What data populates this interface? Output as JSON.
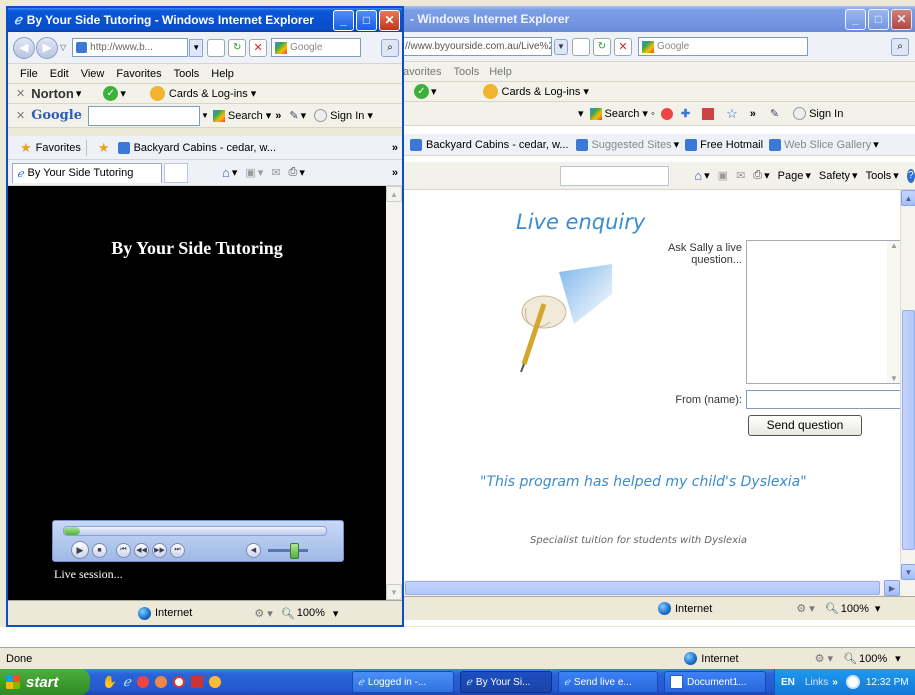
{
  "back_window": {
    "title": "- Windows Internet Explorer",
    "address": "//www.byyourside.com.au/Live%2",
    "search_engine": "Google",
    "menu": [
      "avorites",
      "Tools",
      "Help"
    ],
    "cards_label": "Cards & Log-ins",
    "google_toolbar": {
      "search_label": "Search",
      "signin_label": "Sign In"
    },
    "links": [
      "Backyard Cabins - cedar, w...",
      "Suggested Sites",
      "Free Hotmail",
      "Web Slice Gallery"
    ],
    "commands": {
      "page": "Page",
      "safety": "Safety",
      "tools": "Tools"
    },
    "page": {
      "heading": "Live enquiry",
      "ask_label": "Ask Sally a live question...",
      "from_label": "From (name):",
      "send_button": "Send question",
      "quote": "\"This program has helped my child's Dyslexia\"",
      "tagline": "Specialist tuition for students with Dyslexia"
    },
    "status": {
      "zone": "Internet",
      "zoom": "100%"
    }
  },
  "front_window": {
    "title": "By Your Side Tutoring - Windows Internet Explorer",
    "address": "http://www.b...",
    "search_engine": "Google",
    "menu": [
      "File",
      "Edit",
      "View",
      "Favorites",
      "Tools",
      "Help"
    ],
    "norton_label": "Norton",
    "cards_label": "Cards & Log-ins",
    "google_toolbar": {
      "logo": "Google",
      "search_label": "Search",
      "signin_label": "Sign In"
    },
    "favorites_label": "Favorites",
    "links": [
      "Backyard Cabins - cedar, w..."
    ],
    "tab_label": "By Your Side Tutoring",
    "page": {
      "heading": "By Your Side Tutoring",
      "caption": "Live session..."
    },
    "status": {
      "zone": "Internet",
      "zoom": "100%"
    }
  },
  "bottom_status": {
    "text": "Done",
    "zone": "Internet",
    "zoom": "100%"
  },
  "taskbar": {
    "start_label": "start",
    "buttons": [
      "Logged in -...",
      "By Your Si...",
      "Send live e...",
      "Document1..."
    ],
    "language": "EN",
    "links_label": "Links",
    "clock": "12:32 PM"
  },
  "colors": {
    "accent_blue": "#3a8bd0",
    "xp_blue": "#0a50d0",
    "taskbar_green": "#3c9a2e"
  }
}
